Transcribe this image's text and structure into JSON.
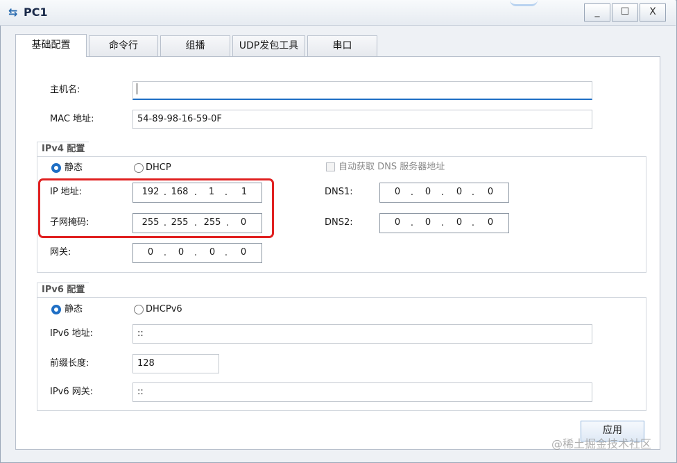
{
  "window": {
    "title": "PC1",
    "minimize": "_",
    "maximize": "☐",
    "close": "X"
  },
  "tabs": [
    "基础配置",
    "命令行",
    "组播",
    "UDP发包工具",
    "串口"
  ],
  "basic": {
    "hostname_label": "主机名:",
    "hostname_value": "",
    "mac_label": "MAC 地址:",
    "mac_value": "54-89-98-16-59-0F"
  },
  "ipv4": {
    "group_title": "IPv4 配置",
    "static_label": "静态",
    "dhcp_label": "DHCP",
    "auto_dns_label": "自动获取 DNS 服务器地址",
    "ip_label": "IP 地址:",
    "ip": [
      "192",
      "168",
      "1",
      "1"
    ],
    "mask_label": "子网掩码:",
    "mask": [
      "255",
      "255",
      "255",
      "0"
    ],
    "gateway_label": "网关:",
    "gateway": [
      "0",
      "0",
      "0",
      "0"
    ],
    "dns1_label": "DNS1:",
    "dns1": [
      "0",
      "0",
      "0",
      "0"
    ],
    "dns2_label": "DNS2:",
    "dns2": [
      "0",
      "0",
      "0",
      "0"
    ],
    "mode": "static"
  },
  "ipv6": {
    "group_title": "IPv6 配置",
    "static_label": "静态",
    "dhcp_label": "DHCPv6",
    "address_label": "IPv6 地址:",
    "address_value": "::",
    "prefix_label": "前缀长度:",
    "prefix_value": "128",
    "gateway_label": "IPv6 网关:",
    "gateway_value": "::",
    "mode": "static"
  },
  "apply_label": "应用",
  "watermark": "@稀土掘金技术社区",
  "colors": {
    "accent": "#1f6fc5",
    "highlight": "#e02020"
  }
}
